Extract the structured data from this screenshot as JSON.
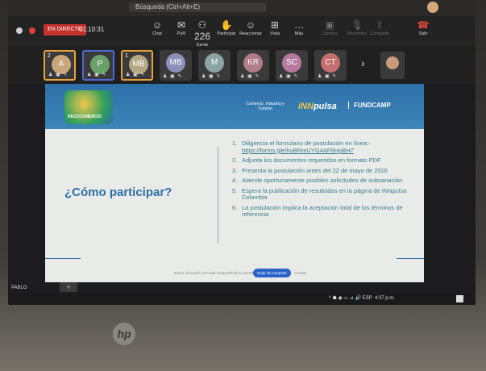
{
  "window": {
    "search_placeholder": "Búsqueda (Ctrl+Alt+E)"
  },
  "meeting": {
    "live_label": "EN DIRECTO",
    "timer": "01:10:31",
    "toolbar": [
      {
        "icon": "chat-icon",
        "glyph": "☺",
        "label": "Chat"
      },
      {
        "icon": "qa-icon",
        "glyph": "✉",
        "label": "PyR"
      },
      {
        "icon": "people-icon",
        "glyph": "⚇",
        "label": "Gente",
        "count": "226"
      },
      {
        "icon": "hand-icon",
        "glyph": "✋",
        "label": "Participar"
      },
      {
        "icon": "react-icon",
        "glyph": "☺",
        "label": "Reaccionar"
      },
      {
        "icon": "view-icon",
        "glyph": "⊞",
        "label": "Vista"
      },
      {
        "icon": "more-icon",
        "glyph": "…",
        "label": "Más"
      },
      {
        "icon": "camera-icon",
        "glyph": "▣",
        "label": "Cámara"
      },
      {
        "icon": "mic-icon",
        "glyph": "🎙",
        "label": "Micrófono"
      },
      {
        "icon": "share-icon",
        "glyph": "⇪",
        "label": "Compartir"
      },
      {
        "icon": "leave-icon",
        "glyph": "☎",
        "label": "Salir"
      }
    ],
    "participants": [
      {
        "initials": "A",
        "badge": "2",
        "color": "#c9a77b",
        "border": "orange"
      },
      {
        "initials": "P",
        "badge": "",
        "color": "#6aa06a",
        "border": "blue"
      },
      {
        "initials": "MB",
        "badge": "1",
        "color": "#b4a884",
        "border": "orange"
      },
      {
        "initials": "MB",
        "badge": "",
        "color": "#8e8fb8",
        "border": ""
      },
      {
        "initials": "M",
        "badge": "",
        "color": "#8aa3a3",
        "border": ""
      },
      {
        "initials": "KR",
        "badge": "",
        "color": "#b07c8a",
        "border": ""
      },
      {
        "initials": "SC",
        "badge": "",
        "color": "#b77a9e",
        "border": ""
      },
      {
        "initials": "CT",
        "badge": "",
        "color": "#c46f6f",
        "border": ""
      }
    ],
    "more_glyph": "›",
    "presenter_name": "PABLO",
    "add_glyph": "+"
  },
  "slide": {
    "left_logo_text": "RECOCOMERCIO",
    "ministry_text": "Comercio, Industria y Turismo",
    "innpulsa_prefix": "iNN",
    "innpulsa_suffix": "pulsa",
    "fundcamp": "FUNDCAMP",
    "heading": "¿Cómo participar?",
    "steps": [
      {
        "num": "1.",
        "text": "Diligencia el formulario de postulación en línea:-",
        "link": "https://forms.gle/huBRmUYG4AF6HpBH7"
      },
      {
        "num": "2.",
        "text": "Adjunta los documentos requeridos en formato PDF",
        "link": ""
      },
      {
        "num": "3.",
        "text": "Presenta la postulación antes del 22 de mayo de 2026",
        "link": ""
      },
      {
        "num": "4.",
        "text": "Atiende oportunamente posibles solicitudes de subsanación",
        "link": ""
      },
      {
        "num": "5.",
        "text": "Espera la publicación de resultados en la página de iNNpulsa Colombia",
        "link": ""
      },
      {
        "num": "6.",
        "text": "La postulación implica la aceptación total de los términos de referencia",
        "link": ""
      }
    ]
  },
  "share_bar": {
    "text": "teams.microsoft.com está compartiendo tu pantalla.",
    "stop_label": "Dejar de compartir",
    "hide_label": "Ocultar"
  },
  "taskbar": {
    "tray": "^  ☗ ◉ ▭ ⊿ 🔊 ESP",
    "time": "4:37 p.m."
  },
  "device": {
    "brand": "hp"
  }
}
